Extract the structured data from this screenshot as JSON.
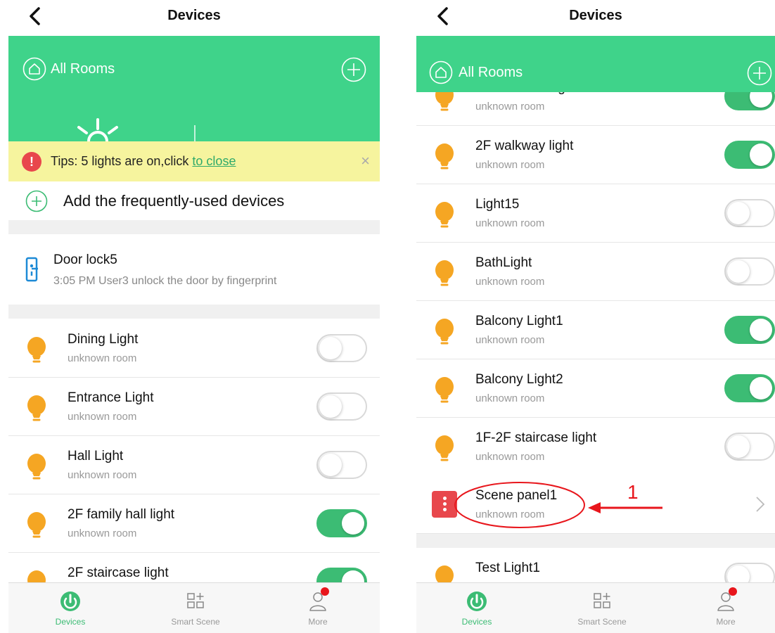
{
  "left": {
    "nav_title": "Devices",
    "header": {
      "rooms_label": "All Rooms"
    },
    "tips": {
      "prefix": "Tips: 5 lights are on,click ",
      "link": "to close",
      "close": "×",
      "warn": "!"
    },
    "add_label": "Add the frequently-used devices",
    "door": {
      "name": "Door lock5",
      "detail": "3:05 PM User3  unlock the door by fingerprint"
    },
    "devices": [
      {
        "name": "Dining Light",
        "room": "unknown room",
        "on": false
      },
      {
        "name": "Entrance Light",
        "room": "unknown room",
        "on": false
      },
      {
        "name": "Hall Light",
        "room": "unknown room",
        "on": false
      },
      {
        "name": "2F family hall light",
        "room": "unknown room",
        "on": true
      },
      {
        "name": "2F staircase light",
        "room": "",
        "on": true
      }
    ]
  },
  "right": {
    "nav_title": "Devices",
    "header": {
      "rooms_label": "All Rooms"
    },
    "partial_top": {
      "name": "2F staircase light",
      "room": "unknown room",
      "on": true
    },
    "devices": [
      {
        "name": "2F walkway light",
        "room": "unknown room",
        "on": true
      },
      {
        "name": "Light15",
        "room": "unknown room",
        "on": false
      },
      {
        "name": "BathLight",
        "room": "unknown room",
        "on": false
      },
      {
        "name": "Balcony Light1",
        "room": "unknown room",
        "on": true
      },
      {
        "name": "Balcony Light2",
        "room": "unknown room",
        "on": true
      },
      {
        "name": "1F-2F staircase light",
        "room": "unknown room",
        "on": false
      }
    ],
    "scene": {
      "name": "Scene panel1",
      "room": "unknown room"
    },
    "test": {
      "name": "Test Light1",
      "on": false
    },
    "annotation_number": "1"
  },
  "tabs": [
    {
      "label": "Devices",
      "icon": "power-icon",
      "active": true
    },
    {
      "label": "Smart Scene",
      "icon": "scene-grid-icon",
      "active": false
    },
    {
      "label": "More",
      "icon": "person-icon",
      "active": false
    }
  ],
  "colors": {
    "accent_green": "#3fd38a",
    "toggle_on": "#3cbc74",
    "bulb": "#f5a623",
    "warning_red": "#e8474c",
    "annotation_red": "#e8161c",
    "tips_bg": "#f6f49e"
  }
}
